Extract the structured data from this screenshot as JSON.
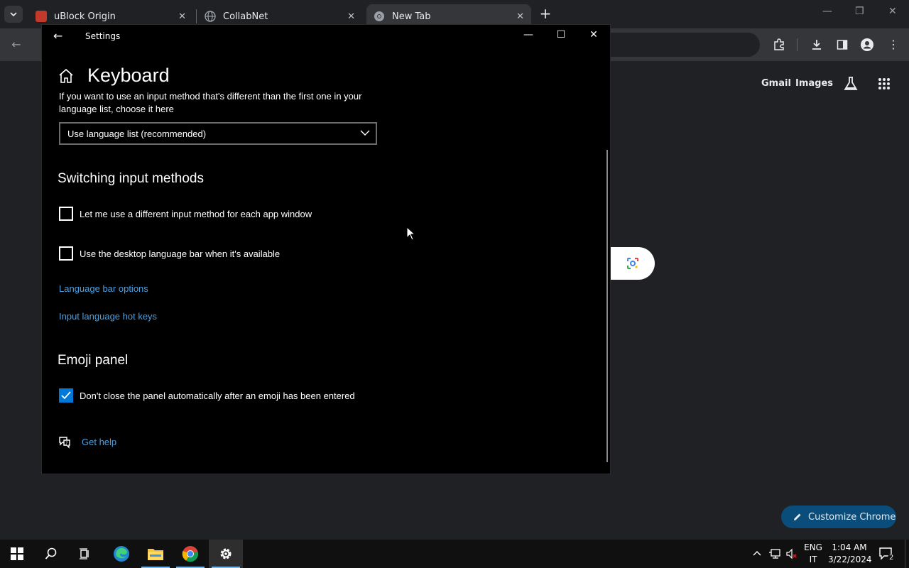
{
  "browser": {
    "tabs": [
      {
        "label": "uBlock Origin",
        "active": false,
        "favicon_color": "#c0392b"
      },
      {
        "label": "CollabNet",
        "active": false,
        "favicon_color": "#9aa0a6"
      },
      {
        "label": "New Tab",
        "active": true,
        "favicon_color": "#9aa0a6"
      }
    ],
    "ntp_links": {
      "gmail": "Gmail",
      "images": "Images"
    },
    "customize_label": "Customize Chrome"
  },
  "settings": {
    "window_title": "Settings",
    "page_title": "Keyboard",
    "input_method_description": "If you want to use an input method that's different than the first one in your language list, choose it here",
    "input_method_dropdown_value": "Use language list (recommended)",
    "switching_heading": "Switching input methods",
    "checkbox_per_app": {
      "label": "Let me use a different input method for each app window",
      "checked": false
    },
    "checkbox_language_bar": {
      "label": "Use the desktop language bar when it's available",
      "checked": false
    },
    "link_language_bar_options": "Language bar options",
    "link_hot_keys": "Input language hot keys",
    "emoji_heading": "Emoji panel",
    "checkbox_emoji": {
      "label": "Don't close the panel automatically after an emoji has been entered",
      "checked": true
    },
    "get_help": "Get help",
    "accent_color": "#0078d7",
    "link_color": "#4ca0e0"
  },
  "taskbar": {
    "language": {
      "line1": "ENG",
      "line2": "IT"
    },
    "time": "1:04 AM",
    "date": "3/22/2024",
    "notification_count": "2"
  }
}
